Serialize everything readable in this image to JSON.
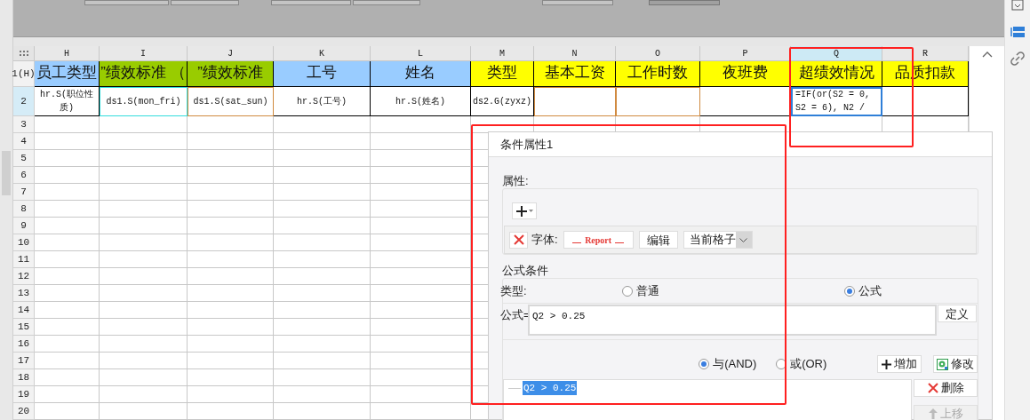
{
  "sheet": {
    "columns": [
      {
        "label": "H",
        "selected": false
      },
      {
        "label": "I",
        "selected": false
      },
      {
        "label": "J",
        "selected": false
      },
      {
        "label": "K",
        "selected": false
      },
      {
        "label": "L",
        "selected": false
      },
      {
        "label": "M",
        "selected": false
      },
      {
        "label": "N",
        "selected": false
      },
      {
        "label": "O",
        "selected": false
      },
      {
        "label": "P",
        "selected": false
      },
      {
        "label": "Q",
        "selected": true
      },
      {
        "label": "R",
        "selected": false
      }
    ],
    "row_numbers": [
      "1(H)",
      "2",
      "3",
      "4",
      "5",
      "6",
      "7",
      "8",
      "9",
      "10",
      "11",
      "12",
      "13",
      "14",
      "15",
      "16",
      "17",
      "18",
      "19",
      "20"
    ],
    "header_cells": [
      {
        "text": "员工类型",
        "color": "#99ccff"
      },
      {
        "text": "”绩效标准 （",
        "color": "#99cc00"
      },
      {
        "text": "”绩效标准",
        "color": "#99cc00"
      },
      {
        "text": "工号",
        "color": "#99ccff"
      },
      {
        "text": "姓名",
        "color": "#99ccff"
      },
      {
        "text": "类型",
        "color": "#ffff00"
      },
      {
        "text": "基本工资",
        "color": "#ffff00"
      },
      {
        "text": "工作时数",
        "color": "#ffff00"
      },
      {
        "text": "夜班费",
        "color": "#ffff00"
      },
      {
        "text": "超绩效情况",
        "color": "#ffff00"
      },
      {
        "text": "品质扣款",
        "color": "#ffff00"
      }
    ],
    "data_cells": [
      {
        "text": "hr.S(职位性质)",
        "selected": false
      },
      {
        "text": "ds1.S(mon_fri)",
        "selected": false,
        "color": "#33dddd"
      },
      {
        "text": "ds1.S(sat_sun)",
        "selected": false,
        "color": "#d08a40"
      },
      {
        "text": "hr.S(工号)",
        "selected": false
      },
      {
        "text": "hr.S(姓名)",
        "selected": false
      },
      {
        "text": "ds2.G(zyxz)",
        "selected": false
      },
      {
        "selected": false,
        "color": "#d08a40"
      },
      {
        "selected": false,
        "color": "#d08a40"
      },
      {
        "selected": false
      },
      {
        "text": "=IF(or(S2 = 0, S2 = 6), N2 /",
        "selected": true
      },
      {
        "selected": false
      }
    ]
  },
  "dialog": {
    "title": "条件属性1",
    "properties": {
      "legend": "属性:",
      "font_label": "字体:",
      "font_preview": "Report",
      "edit_button": "编辑",
      "scope": "当前格子"
    },
    "formula_condition": {
      "legend": "公式条件",
      "type_label": "类型:",
      "type_options": [
        {
          "label": "普通",
          "selected": false
        },
        {
          "label": "公式",
          "selected": true
        }
      ],
      "formula_label": "公式=",
      "formula": "Q2 > 0.25",
      "define_button": "定义",
      "logic_options": [
        {
          "label": "与(AND)",
          "selected": true
        },
        {
          "label": "或(OR)",
          "selected": false
        }
      ],
      "add_button": "增加",
      "modify_button": "修改",
      "conditions": [
        {
          "text": "Q2 > 0.25",
          "selected": true
        }
      ],
      "delete_button": {
        "label": "删除",
        "disabled": false
      },
      "move_up_button": {
        "label": "上移",
        "disabled": true
      }
    }
  }
}
